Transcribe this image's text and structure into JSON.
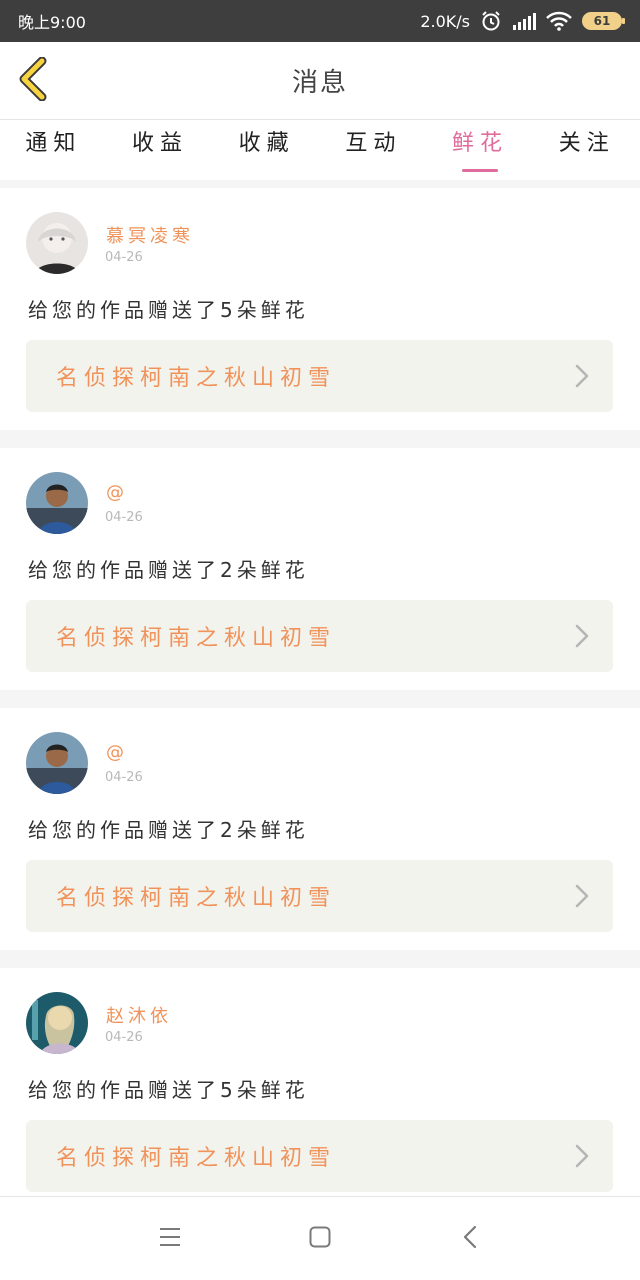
{
  "status_bar": {
    "time": "晚上9:00",
    "speed": "2.0K/s",
    "battery": "61",
    "icons": [
      "alarm-icon",
      "signal-icon",
      "wifi-icon",
      "battery-icon"
    ]
  },
  "header": {
    "title": "消息",
    "back_icon": "chevron-left-icon"
  },
  "tabs": [
    {
      "label": "通知",
      "active": false
    },
    {
      "label": "收益",
      "active": false
    },
    {
      "label": "收藏",
      "active": false
    },
    {
      "label": "互动",
      "active": false
    },
    {
      "label": "鲜花",
      "active": true
    },
    {
      "label": "关注",
      "active": false
    }
  ],
  "messages": [
    {
      "username": "慕冥凌寒",
      "date": "04-26",
      "message": "给您的作品赠送了5朵鲜花",
      "work_title": "名侦探柯南之秋山初雪"
    },
    {
      "username": "@",
      "date": "04-26",
      "message": "给您的作品赠送了2朵鲜花",
      "work_title": "名侦探柯南之秋山初雪"
    },
    {
      "username": "@",
      "date": "04-26",
      "message": "给您的作品赠送了2朵鲜花",
      "work_title": "名侦探柯南之秋山初雪"
    },
    {
      "username": "赵沐依",
      "date": "04-26",
      "message": "给您的作品赠送了5朵鲜花",
      "work_title": "名侦探柯南之秋山初雪"
    }
  ],
  "bottom_nav": {
    "icons": [
      "menu-icon",
      "home-square-icon",
      "back-arrow-icon"
    ]
  },
  "colors": {
    "accent_pink": "#e06c9b",
    "username_orange": "#f0935a",
    "back_chevron_yellow": "#f6d33f"
  }
}
